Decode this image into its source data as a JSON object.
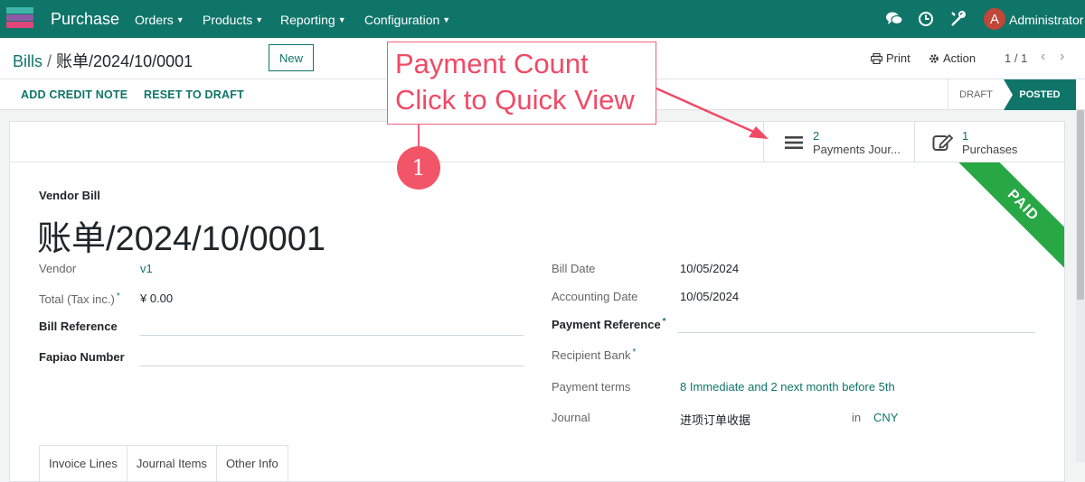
{
  "navbar": {
    "app_name": "Purchase",
    "menus": [
      "Orders",
      "Products",
      "Reporting",
      "Configuration"
    ],
    "user_initial": "A",
    "user_name": "Administrator",
    "icons": [
      "discuss-icon",
      "activity-clock-icon",
      "debug-tools-icon"
    ]
  },
  "control_panel": {
    "breadcrumb_parent": "Bills",
    "breadcrumb_current": "账单/2024/10/0001",
    "new_label": "New",
    "print_label": "Print",
    "action_label": "Action",
    "pager": "1 / 1"
  },
  "statusbar": {
    "buttons": [
      "ADD CREDIT NOTE",
      "RESET TO DRAFT"
    ],
    "stages": [
      "DRAFT",
      "POSTED"
    ],
    "active_stage": "POSTED"
  },
  "smart_buttons": [
    {
      "count": "2",
      "label": "Payments Jour...",
      "icon": "list-icon"
    },
    {
      "count": "1",
      "label": "Purchases",
      "icon": "edit-icon"
    }
  ],
  "ribbon": "PAID",
  "form": {
    "doc_type": "Vendor Bill",
    "doc_name": "账单/2024/10/0001",
    "vendor_label": "Vendor",
    "vendor_value": "v1",
    "total_label": "Total (Tax inc.)",
    "total_value": "¥ 0.00",
    "bill_ref_label": "Bill Reference",
    "fapiao_label": "Fapiao Number",
    "bill_date_label": "Bill Date",
    "bill_date_value": "10/05/2024",
    "accounting_date_label": "Accounting Date",
    "accounting_date_value": "10/05/2024",
    "payment_ref_label": "Payment Reference",
    "recipient_bank_label": "Recipient Bank",
    "payment_terms_label": "Payment terms",
    "payment_terms_value": "8 Immediate and 2 next month before 5th",
    "journal_label": "Journal",
    "journal_value": "进项订单收据",
    "journal_in": "in",
    "journal_currency": "CNY"
  },
  "tabs": [
    "Invoice Lines",
    "Journal Items",
    "Other Info"
  ],
  "annotation": {
    "line1": "Payment Count",
    "line2": "Click to Quick View",
    "badge": "1"
  },
  "colors": {
    "brand": "#0f7569",
    "ribbon_green": "#28a745",
    "annotation_red": "#f04a66"
  }
}
